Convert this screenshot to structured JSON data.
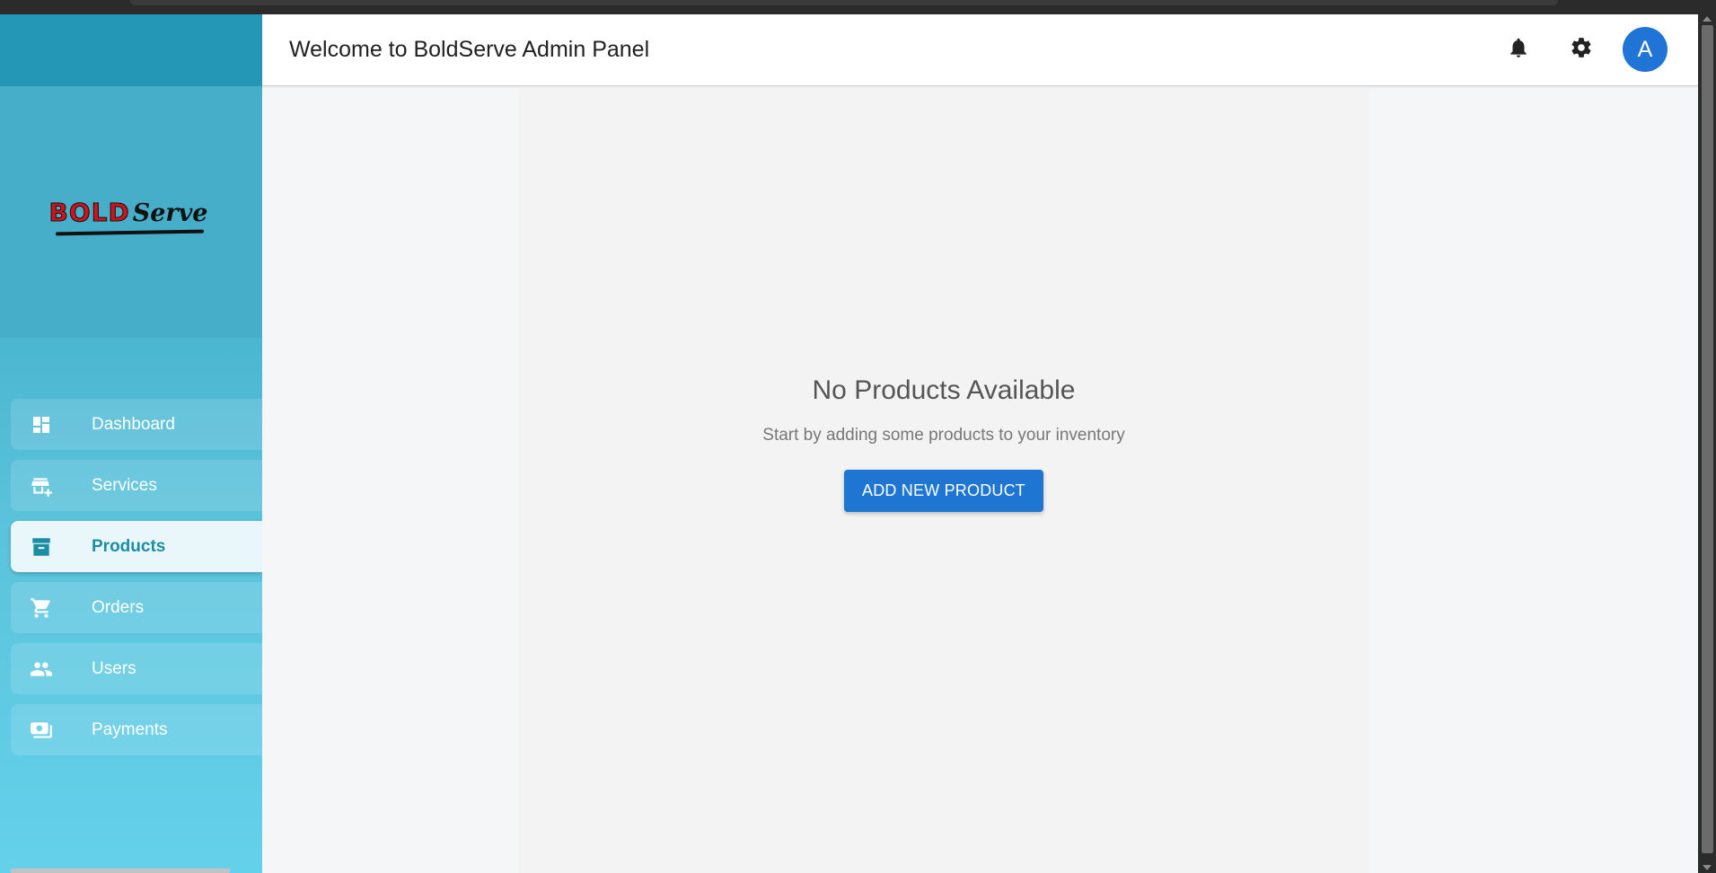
{
  "header": {
    "title": "Welcome to BoldServe Admin Panel",
    "notification_icon": "bell-icon",
    "settings_icon": "gear-icon",
    "avatar_initial": "A"
  },
  "sidebar": {
    "logo": {
      "part1": "BOLD",
      "part2": "Serve"
    },
    "items": [
      {
        "label": "Dashboard",
        "icon": "dashboard-icon",
        "active": false
      },
      {
        "label": "Services",
        "icon": "store-add-icon",
        "active": false
      },
      {
        "label": "Products",
        "icon": "archive-box-icon",
        "active": true
      },
      {
        "label": "Orders",
        "icon": "cart-icon",
        "active": false
      },
      {
        "label": "Users",
        "icon": "people-icon",
        "active": false
      },
      {
        "label": "Payments",
        "icon": "payments-icon",
        "active": false
      }
    ]
  },
  "main": {
    "empty_state": {
      "heading": "No Products Available",
      "subtext": "Start by adding some products to your inventory",
      "button_label": "ADD NEW PRODUCT"
    }
  },
  "colors": {
    "accent": "#1e76d2",
    "sidebar_top": "#2496b6",
    "sidebar_bottom": "#64d1ea",
    "active_text": "#1b8ea6",
    "logo_red": "#d0121b"
  }
}
